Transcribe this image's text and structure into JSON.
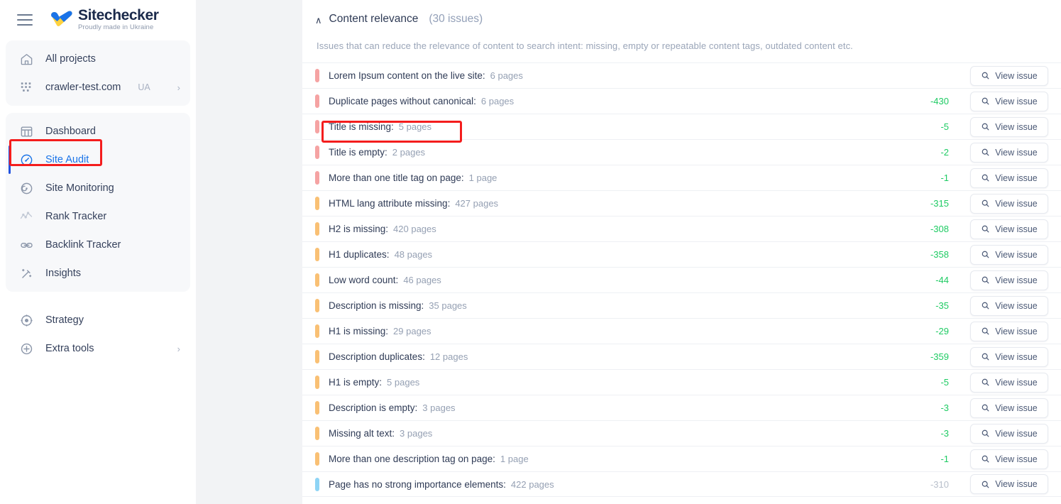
{
  "brand": {
    "name": "Sitechecker",
    "tagline": "Proudly made in Ukraine",
    "menu_icon": "hamburger-icon",
    "logo_icon": "sitechecker-heart-check-logo"
  },
  "sidebar": {
    "group_projects": [
      {
        "label": "All projects",
        "icon": "home-icon",
        "sup": "",
        "chevron": ""
      },
      {
        "label": "crawler-test.com",
        "icon": "grid-dots-icon",
        "sup": "UA",
        "chevron": "›"
      }
    ],
    "group_tools": [
      {
        "label": "Dashboard",
        "icon": "dashboard-columns-icon",
        "active": false,
        "dim": false
      },
      {
        "label": "Site Audit",
        "icon": "speedometer-icon",
        "active": true,
        "dim": false
      },
      {
        "label": "Site Monitoring",
        "icon": "radar-icon",
        "active": false,
        "dim": false
      },
      {
        "label": "Rank Tracker",
        "icon": "line-chart-icon",
        "active": false,
        "dim": true
      },
      {
        "label": "Backlink Tracker",
        "icon": "link-chain-icon",
        "active": false,
        "dim": false
      },
      {
        "label": "Insights",
        "icon": "magic-wand-icon",
        "active": false,
        "dim": false
      }
    ],
    "group_extra": [
      {
        "label": "Strategy",
        "icon": "target-icon",
        "chevron": ""
      },
      {
        "label": "Extra tools",
        "icon": "plus-circle-icon",
        "chevron": "›"
      }
    ]
  },
  "panel": {
    "caret": "∧",
    "title": "Content relevance",
    "count": "(30 issues)",
    "description": "Issues that can reduce the relevance of content to search intent: missing, empty or repeatable content tags, outdated content etc.",
    "view_button_label": "View issue",
    "view_button_icon": "magnifier-icon"
  },
  "colors": {
    "critical": "#f5a3a3",
    "warning": "#f9c074",
    "notice": "#8ed4f5",
    "delta_positive": "#1ecb63",
    "delta_muted": "#b8bfcb",
    "accent": "#1a73e8",
    "active_bar": "#2253e0",
    "highlight_box": "#f41d1d"
  },
  "issues": [
    {
      "label": "Lorem Ipsum content on the live site:",
      "pages": "6 pages",
      "delta": "",
      "severity": "critical",
      "muted": false
    },
    {
      "label": "Duplicate pages without canonical:",
      "pages": "6 pages",
      "delta": "-430",
      "severity": "critical",
      "muted": false
    },
    {
      "label": "Title is missing:",
      "pages": "5 pages",
      "delta": "-5",
      "severity": "critical",
      "muted": false
    },
    {
      "label": "Title is empty:",
      "pages": "2 pages",
      "delta": "-2",
      "severity": "critical",
      "muted": false
    },
    {
      "label": "More than one title tag on page:",
      "pages": "1 page",
      "delta": "-1",
      "severity": "critical",
      "muted": false
    },
    {
      "label": "HTML lang attribute missing:",
      "pages": "427 pages",
      "delta": "-315",
      "severity": "warning",
      "muted": false
    },
    {
      "label": "H2 is missing:",
      "pages": "420 pages",
      "delta": "-308",
      "severity": "warning",
      "muted": false
    },
    {
      "label": "H1 duplicates:",
      "pages": "48 pages",
      "delta": "-358",
      "severity": "warning",
      "muted": false
    },
    {
      "label": "Low word count:",
      "pages": "46 pages",
      "delta": "-44",
      "severity": "warning",
      "muted": false
    },
    {
      "label": "Description is missing:",
      "pages": "35 pages",
      "delta": "-35",
      "severity": "warning",
      "muted": false
    },
    {
      "label": "H1 is missing:",
      "pages": "29 pages",
      "delta": "-29",
      "severity": "warning",
      "muted": false
    },
    {
      "label": "Description duplicates:",
      "pages": "12 pages",
      "delta": "-359",
      "severity": "warning",
      "muted": false
    },
    {
      "label": "H1 is empty:",
      "pages": "5 pages",
      "delta": "-5",
      "severity": "warning",
      "muted": false
    },
    {
      "label": "Description is empty:",
      "pages": "3 pages",
      "delta": "-3",
      "severity": "warning",
      "muted": false
    },
    {
      "label": "Missing alt text:",
      "pages": "3 pages",
      "delta": "-3",
      "severity": "warning",
      "muted": false
    },
    {
      "label": "More than one description tag on page:",
      "pages": "1 page",
      "delta": "-1",
      "severity": "warning",
      "muted": false
    },
    {
      "label": "Page has no strong importance elements:",
      "pages": "422 pages",
      "delta": "-310",
      "severity": "notice",
      "muted": true
    }
  ],
  "annotations": [
    {
      "name": "highlight-site-audit",
      "target": "sidebar-item-site-audit"
    },
    {
      "name": "highlight-title-is-missing",
      "target": "issue-row-title-is-missing"
    }
  ]
}
